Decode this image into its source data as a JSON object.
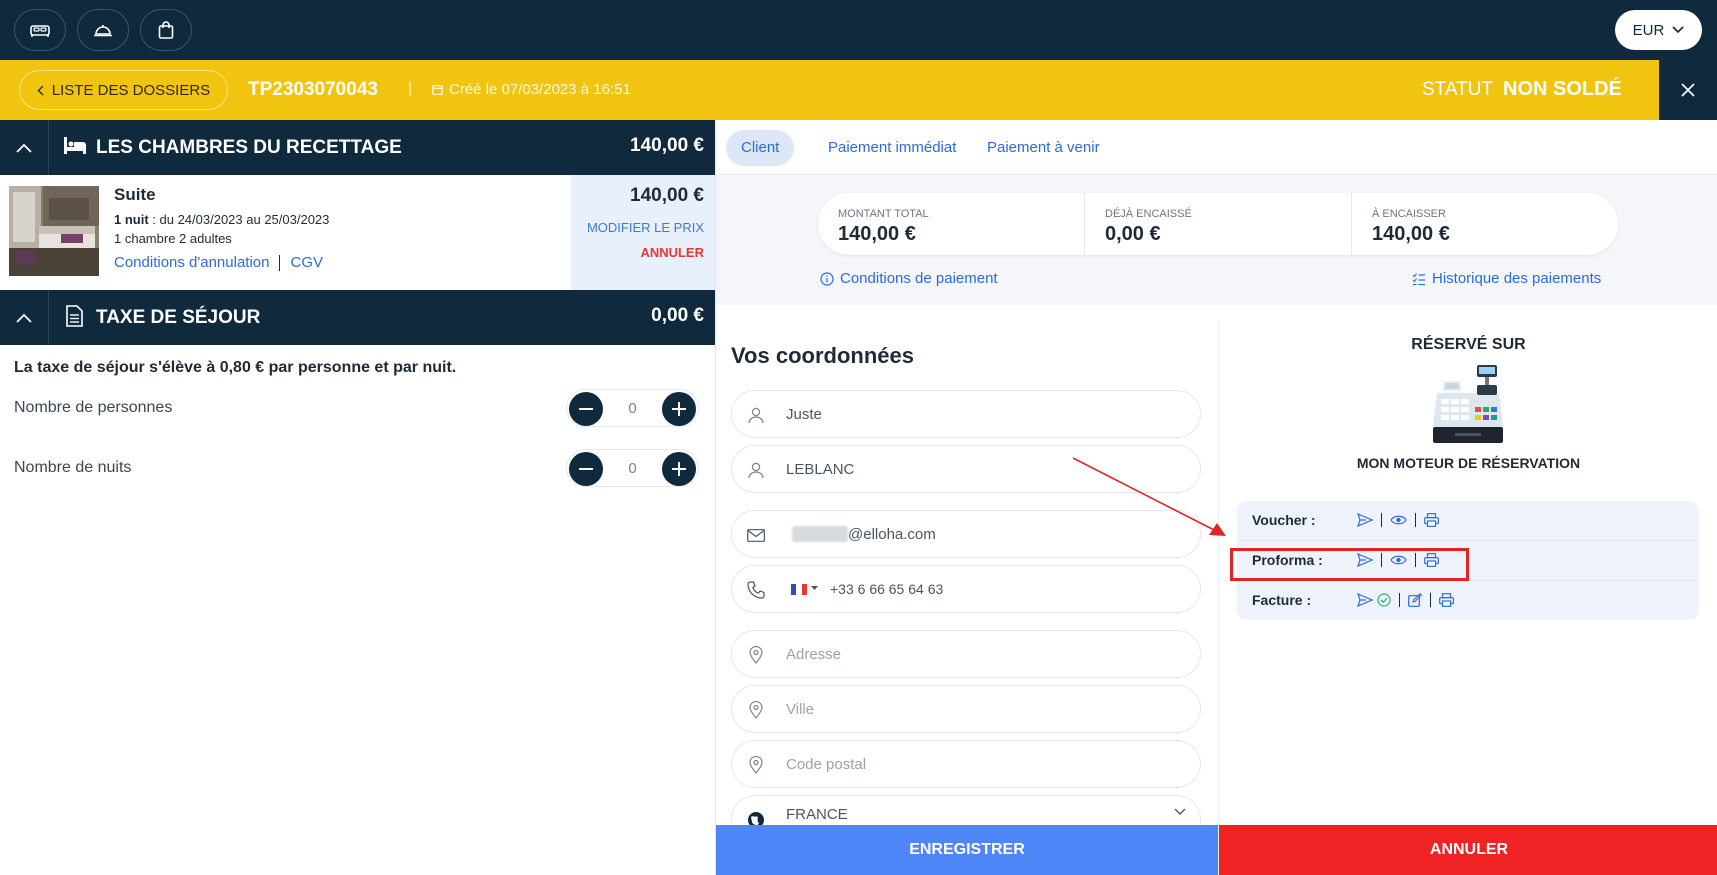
{
  "topbar": {
    "icons": [
      "bed-icon",
      "cloche-icon",
      "shopping-bag-icon"
    ],
    "currency": "EUR"
  },
  "dossier": {
    "back_label": "LISTE DES DOSSIERS",
    "reference": "TP2303070043",
    "separator": "|",
    "created": "Créé le 07/03/2023 à 16:51",
    "status_label": "STATUT",
    "status_value": "NON SOLDÉ"
  },
  "rooms": {
    "title": "LES CHAMBRES DU RECETTAGE",
    "total": "140,00 €",
    "item": {
      "name": "Suite",
      "nights_bold": "1 nuit",
      "dates": " : du 24/03/2023 au 25/03/2023",
      "occupancy": "1 chambre 2 adultes",
      "link_conditions": "Conditions d'annulation",
      "link_cgv": "CGV",
      "price": "140,00 €",
      "modify_label": "MODIFIER LE PRIX",
      "cancel_label": "ANNULER"
    }
  },
  "tax": {
    "title": "TAXE DE SÉJOUR",
    "total": "0,00 €",
    "description": "La taxe de séjour s'élève à 0,80 € par personne et par nuit.",
    "persons_label": "Nombre de personnes",
    "persons_value": "0",
    "nights_label": "Nombre de nuits",
    "nights_value": "0"
  },
  "tabs": [
    {
      "label": "Client",
      "active": true
    },
    {
      "label": "Paiement immédiat",
      "active": false
    },
    {
      "label": "Paiement à venir",
      "active": false
    }
  ],
  "summary": {
    "total_label": "MONTANT TOTAL",
    "total_value": "140,00 €",
    "paid_label": "DÉJÀ ENCAISSÉ",
    "paid_value": "0,00 €",
    "due_label": "À ENCAISSER",
    "due_value": "140,00 €",
    "conditions_link": "Conditions de paiement",
    "history_link": "Historique des paiements"
  },
  "contact": {
    "title": "Vos coordonnées",
    "first_name": "Juste",
    "last_name": "LEBLANC",
    "email_visible": "@elloha.com",
    "phone": "+33 6 66 65 64 63",
    "address_placeholder": "Adresse",
    "city_placeholder": "Ville",
    "postal_placeholder": "Code postal",
    "country": "FRANCE"
  },
  "booked_on": {
    "title": "RÉSERVÉ SUR",
    "source": "MON MOTEUR DE RÉSERVATION",
    "documents": [
      {
        "label": "Voucher :"
      },
      {
        "label": "Proforma :"
      },
      {
        "label": "Facture :"
      }
    ]
  },
  "actions": {
    "save": "ENREGISTRER",
    "cancel": "ANNULER"
  },
  "colors": {
    "navy": "#0f2a3d",
    "yellow": "#f1c40f",
    "link_blue": "#2b6be0",
    "save_blue": "#4f86f7",
    "cancel_red": "#ef2323",
    "highlight_red": "#e02424",
    "check_green": "#2bb673"
  }
}
